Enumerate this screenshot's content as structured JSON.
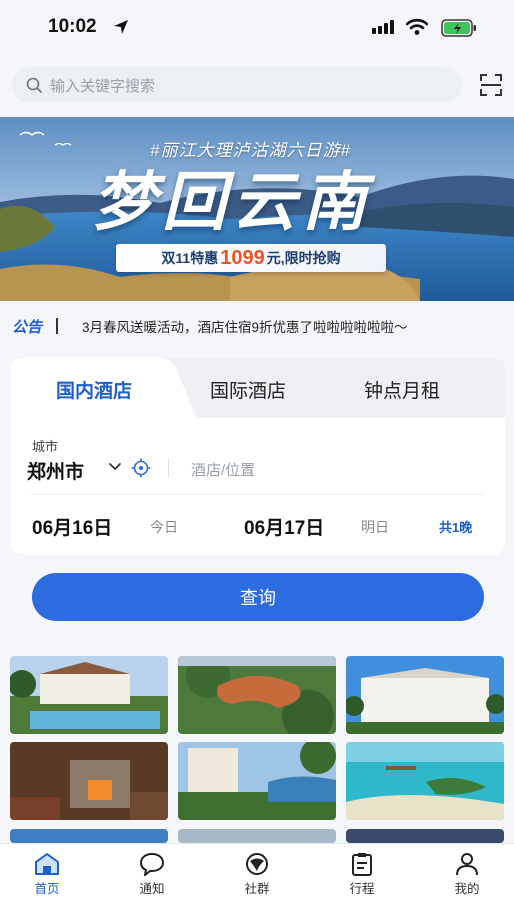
{
  "status_bar": {
    "time": "10:02"
  },
  "search": {
    "placeholder": "输入关键字搜索"
  },
  "banner": {
    "tag": "#丽江大理泸沽湖六日游#",
    "title": "梦回云南",
    "promo_pre": "双11特惠",
    "promo_price": "1099",
    "promo_post": "元,限时抢购"
  },
  "notice": {
    "label": "公告",
    "text": "3月春风送暖活动，酒店住宿9折优惠了啦啦啦啦啦啦～"
  },
  "booking": {
    "tabs": [
      "国内酒店",
      "国际酒店",
      "钟点月租"
    ],
    "city_label": "城市",
    "city_value": "郑州市",
    "hotel_placeholder": "酒店/位置",
    "checkin_date": "06月16日",
    "checkin_tag": "今日",
    "checkout_date": "06月17日",
    "checkout_tag": "明日",
    "nights": "共1晚"
  },
  "query_button": {
    "label": "查询"
  },
  "tab_bar": {
    "items": [
      {
        "label": "首页",
        "icon": "home-icon",
        "active": true
      },
      {
        "label": "通知",
        "icon": "chat-bubble-icon",
        "active": false
      },
      {
        "label": "社群",
        "icon": "community-icon",
        "active": false
      },
      {
        "label": "行程",
        "icon": "clipboard-icon",
        "active": false
      },
      {
        "label": "我的",
        "icon": "user-icon",
        "active": false
      }
    ]
  },
  "colors": {
    "accent": "#2d6be0",
    "active_tab": "#1f5fcc",
    "promo_price": "#e8562a",
    "page_bg": "#f4f6f9"
  }
}
